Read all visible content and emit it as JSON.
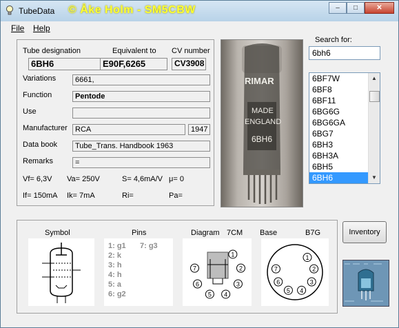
{
  "window": {
    "title": "TubeData",
    "banner": "© Åke Holm - SM5CBW",
    "caption": {
      "minimize": "–",
      "maximize": "□",
      "close": "✕"
    }
  },
  "menu": {
    "file": "File",
    "help": "Help"
  },
  "tube": {
    "designation_label": "Tube designation",
    "designation": "6BH6",
    "equivalent_label": "Equivalent to",
    "equivalent": "E90F,6265",
    "cv_label": "CV number",
    "cv": "CV3908",
    "variations_label": "Variations",
    "variations": "6661,",
    "function_label": "Function",
    "function": "Pentode",
    "use_label": "Use",
    "use": "",
    "manufacturer_label": "Manufacturer",
    "manufacturer": "RCA",
    "year": "1947",
    "databook_label": "Data book",
    "databook": "Tube_Trans. Handbook 1963",
    "remarks_label": "Remarks",
    "remarks": "=",
    "vf": "Vf= 6,3V",
    "va": "Va= 250V",
    "s": "S= 4,6mA/V",
    "mu": "μ=   0",
    "if": "If= 150mA",
    "ik": "Ik=  7mA",
    "ri": "Ri=",
    "pa": "Pa="
  },
  "photo": {
    "text1": "RIMAR",
    "text2": "MADE",
    "text3": "ENGLAND",
    "text4": "6BH6"
  },
  "search": {
    "label": "Search for:",
    "value": "6bh6"
  },
  "tube_list": [
    "6BF7W",
    "6BF8",
    "6BF11",
    "6BG6G",
    "6BG6GA",
    "6BG7",
    "6BH3",
    "6BH3A",
    "6BH5",
    "6BH6"
  ],
  "tube_list_selected": "6BH6",
  "bottom": {
    "symbol_label": "Symbol",
    "pins_label": "Pins",
    "diagram_label": "Diagram",
    "diagram_code": "7CM",
    "base_label": "Base",
    "base_code": "B7G",
    "pins": [
      "1: g1",
      "2: k",
      "3: h",
      "4: h",
      "5: a",
      "6: g2"
    ],
    "pins_col2": [
      "7: g3"
    ],
    "diagram_pin_numbers": [
      "1",
      "2",
      "3",
      "4",
      "5",
      "6",
      "7"
    ],
    "base_pin_numbers": [
      "1",
      "2",
      "3",
      "4",
      "5",
      "6",
      "7"
    ]
  },
  "inventory_button": "Inventory",
  "colors": {
    "banner": "#ffff33",
    "selection": "#3399ff",
    "titlebar": "#c4dbee"
  }
}
